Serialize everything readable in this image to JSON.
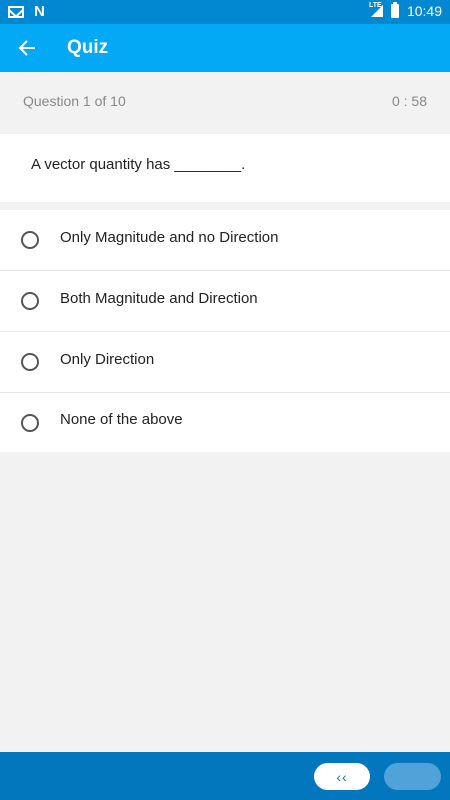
{
  "status_bar": {
    "icons": [
      "gmail-icon",
      "n-icon",
      "lte-signal-icon",
      "battery-icon"
    ],
    "lte_label": "LTE",
    "n_label": "N",
    "time": "10:49"
  },
  "app_bar": {
    "title": "Quiz",
    "back_icon": "arrow-left-icon",
    "color": "#03a9f4"
  },
  "quiz": {
    "progress": "Question 1 of  10",
    "timer": "0 : 58",
    "question": "A vector quantity has ________.",
    "options": [
      {
        "label": "Only Magnitude and no Direction"
      },
      {
        "label": "Both Magnitude and Direction"
      },
      {
        "label": "Only Direction"
      },
      {
        "label": "None of the above"
      }
    ]
  },
  "bottom_bar": {
    "prev_label": "‹‹",
    "color": "#0277bd"
  }
}
